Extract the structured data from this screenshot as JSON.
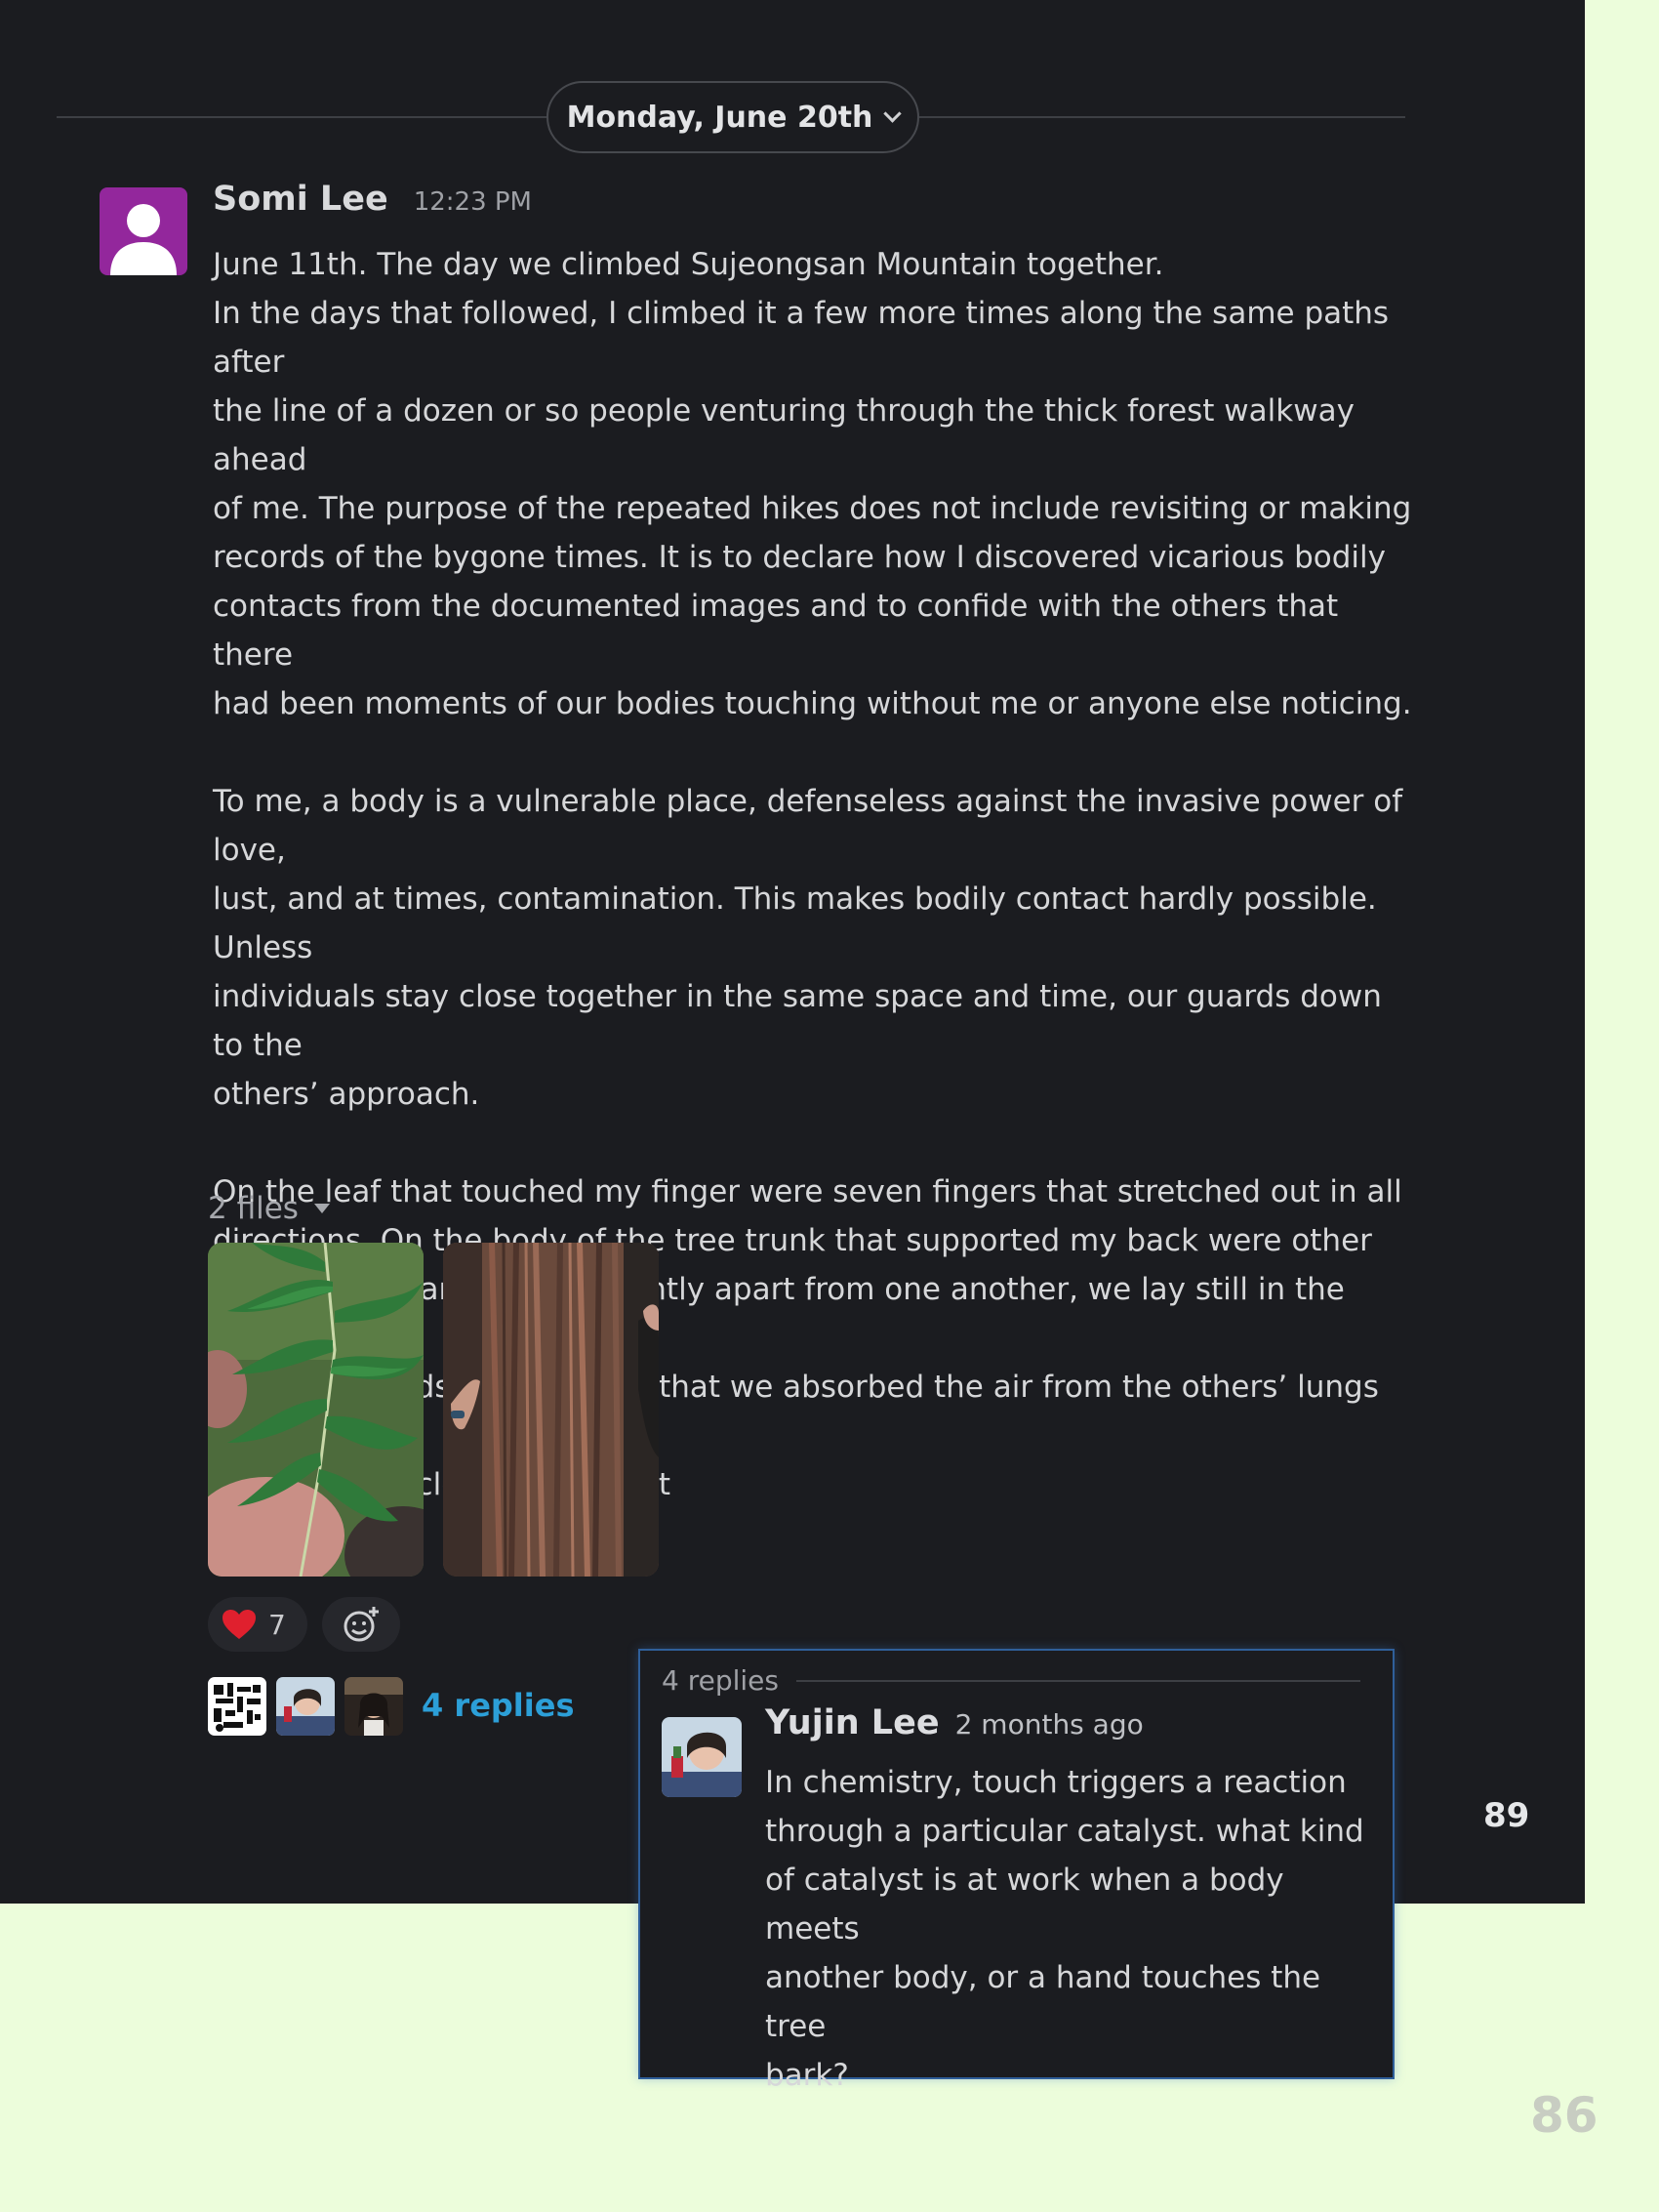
{
  "date_divider": {
    "label": "Monday, June 20th"
  },
  "message": {
    "author": "Somi Lee",
    "time": "12:23 PM",
    "paragraph1_lines": [
      "June 11th. The day we climbed Sujeongsan Mountain together.",
      "In the days that followed, I climbed it a few more times along the same paths after",
      "the line of a dozen or so people venturing through the thick forest walkway ahead",
      "of me. The purpose of the repeated hikes does not include revisiting or making",
      "records of the bygone times. It is to declare how I discovered vicarious bodily",
      "contacts from the documented images and to confide with the others that there",
      "had been moments of our bodies touching without me or anyone else noticing."
    ],
    "paragraph2_lines": [
      "To me, a body is a vulnerable place, defenseless against the invasive power of love,",
      "lust, and at times, contamination. This makes bodily contact hardly possible. Unless",
      "individuals stay close together in the same space and time, our guards down to the",
      "others’ approach."
    ],
    "paragraph3_lines": [
      "On the leaf that touched my finger were seven fingers that stretched out in all",
      "directions. On the body of the tree trunk that supported my back were other",
      "bodies that leaned on it. Slightly apart from one another, we lay still in the cypress",
      "forest. (In hindsight) I realize that we absorbed the air from the others’ lungs along",
      "with the particles of the forest"
    ],
    "files_label": "2 files",
    "attachments": [
      "leaf-photo",
      "tree-bark-photo"
    ],
    "reaction": {
      "emoji": "heart-icon",
      "count": "7"
    },
    "replies_link": "4 replies"
  },
  "thread": {
    "count_label": "4 replies",
    "author": "Yujin Lee",
    "time": "2 months ago",
    "body_lines": [
      "In chemistry, touch triggers a reaction",
      "through a particular catalyst. what kind",
      "of catalyst is at work when a body meets",
      "another body, or a hand touches the tree",
      "bark?"
    ]
  },
  "page_numbers": {
    "inner": "89",
    "outer": "86"
  },
  "colors": {
    "background_page": "#ecfddb",
    "screen_bg": "#1b1c20",
    "avatar_purple": "#93279c",
    "link_blue": "#2c9fd8",
    "thread_border": "#2f5f9a",
    "heart_red": "#e0202e"
  }
}
